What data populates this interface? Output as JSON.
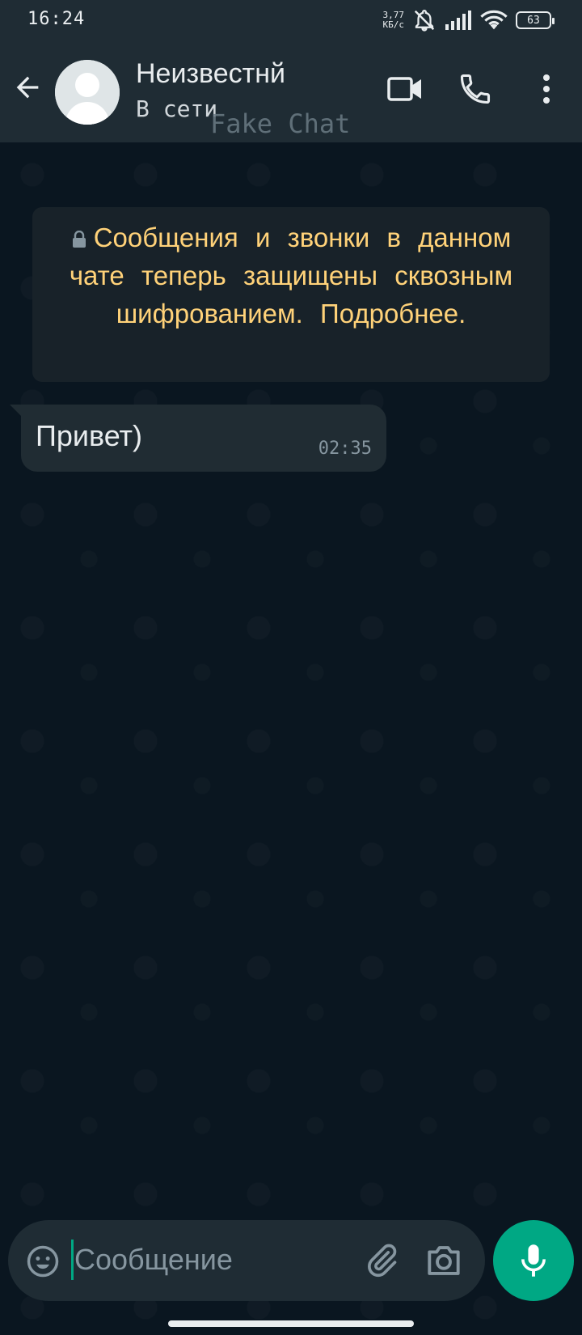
{
  "status_bar": {
    "time": "16:24",
    "net_speed_value": "3,77",
    "net_speed_unit": "КБ/с",
    "battery_level": "63",
    "icons": [
      "muted-bell-icon",
      "signal-icon",
      "wifi-icon",
      "battery-icon"
    ]
  },
  "header": {
    "contact_name": "Неизвестнй",
    "contact_status": "В сети",
    "watermark": "Fake Chat",
    "icons": [
      "back-arrow-icon",
      "avatar-placeholder-icon",
      "video-call-icon",
      "phone-icon",
      "more-vert-icon"
    ]
  },
  "notice": {
    "text": "Сообщения и звонки в данном чате теперь защищены сквозным шифрованием. Подробнее.",
    "icon": "lock-icon"
  },
  "messages": [
    {
      "text": "Привет)",
      "time": "02:35",
      "direction": "incoming"
    }
  ],
  "input_bar": {
    "placeholder": "Сообщение",
    "icons": [
      "emoji-icon",
      "paperclip-icon",
      "camera-icon",
      "mic-icon"
    ]
  },
  "colors": {
    "header_bg": "#1f2c34",
    "chat_bg": "#0a1620",
    "bubble_bg": "#202c33",
    "notice_text": "#ffd279",
    "accent": "#00a884"
  }
}
